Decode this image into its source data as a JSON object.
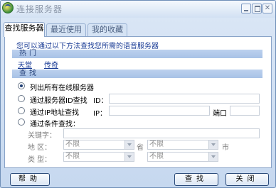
{
  "window": {
    "title": "连接服务器"
  },
  "tabs": [
    {
      "label": "查找服务器",
      "active": true
    },
    {
      "label": "最近使用",
      "active": false
    },
    {
      "label": "我的收藏",
      "active": false
    }
  ],
  "intro_text": "您可以通过以下方法查找您所需的语音服务器",
  "hot": {
    "heading": "热门",
    "links": [
      "天堂",
      "传奇"
    ]
  },
  "search": {
    "heading": "查找",
    "options": [
      {
        "label": "列出所有在线服务器",
        "selected": true
      },
      {
        "label": "通过服务器ID查找",
        "selected": false
      },
      {
        "label": "通过IP地址查找",
        "selected": false
      },
      {
        "label": "通过条件查找：",
        "selected": false
      }
    ],
    "id_label": "ID：",
    "ip_label": "IP：",
    "port_label": "端口",
    "keyword_label": "关键字：",
    "region_label": "地  区：",
    "province_label": "省",
    "city_label": "市",
    "type_label": "类  型：",
    "region_value": "不限",
    "city_value": "不限",
    "type_value": "不限",
    "type_value2": "不限"
  },
  "buttons": {
    "help": "帮助",
    "search": "查找",
    "close": "关闭"
  },
  "icons": [
    "app-icon",
    "minimize-icon",
    "maximize-icon",
    "close-icon"
  ],
  "colors": {
    "accent": "#1a3c96",
    "section_bar": "#b4cbea",
    "border": "#8aa4c9"
  }
}
